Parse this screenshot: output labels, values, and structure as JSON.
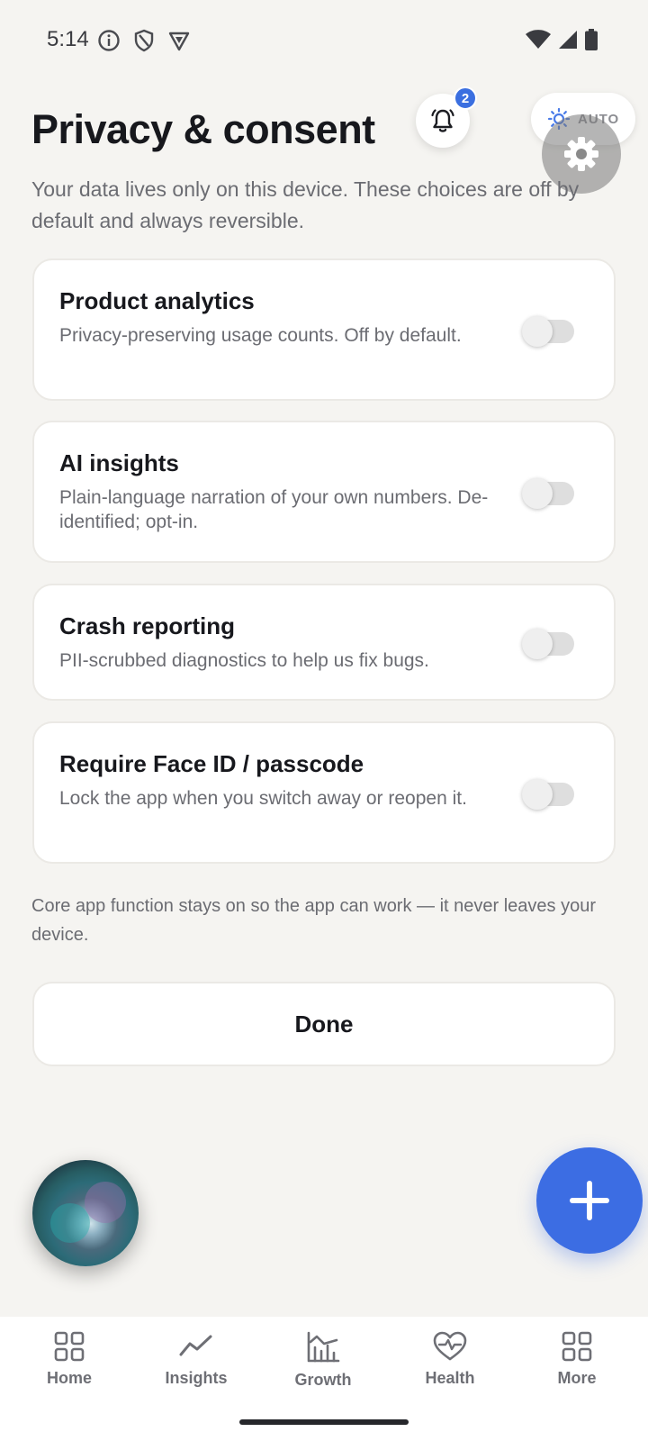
{
  "status_bar": {
    "time": "5:14"
  },
  "header": {
    "title": "Privacy & consent",
    "notification_count": "2",
    "theme_label": "AUTO"
  },
  "intro": "Your data lives only on this device. These choices are off by default and always reversible.",
  "settings": [
    {
      "title": "Product analytics",
      "description": "Privacy-preserving usage counts. Off by default.",
      "enabled": false
    },
    {
      "title": "AI insights",
      "description": "Plain-language narration of your own numbers. De-identified; opt-in.",
      "enabled": false
    },
    {
      "title": "Crash reporting",
      "description": "PII-scrubbed diagnostics to help us fix bugs.",
      "enabled": false
    },
    {
      "title": "Require Face ID / passcode",
      "description": "Lock the app when you switch away or reopen it.",
      "enabled": false
    }
  ],
  "footnote": "Core app function stays on so the app can work — it never leaves your device.",
  "done_label": "Done",
  "nav": {
    "items": [
      {
        "label": "Home",
        "icon": "grid-icon"
      },
      {
        "label": "Insights",
        "icon": "trend-line-icon"
      },
      {
        "label": "Growth",
        "icon": "growth-chart-icon"
      },
      {
        "label": "Health",
        "icon": "heart-pulse-icon"
      },
      {
        "label": "More",
        "icon": "grid-icon"
      }
    ]
  },
  "colors": {
    "accent": "#3c6de3",
    "background": "#f5f4f1",
    "badge": "#3b6fe0"
  }
}
